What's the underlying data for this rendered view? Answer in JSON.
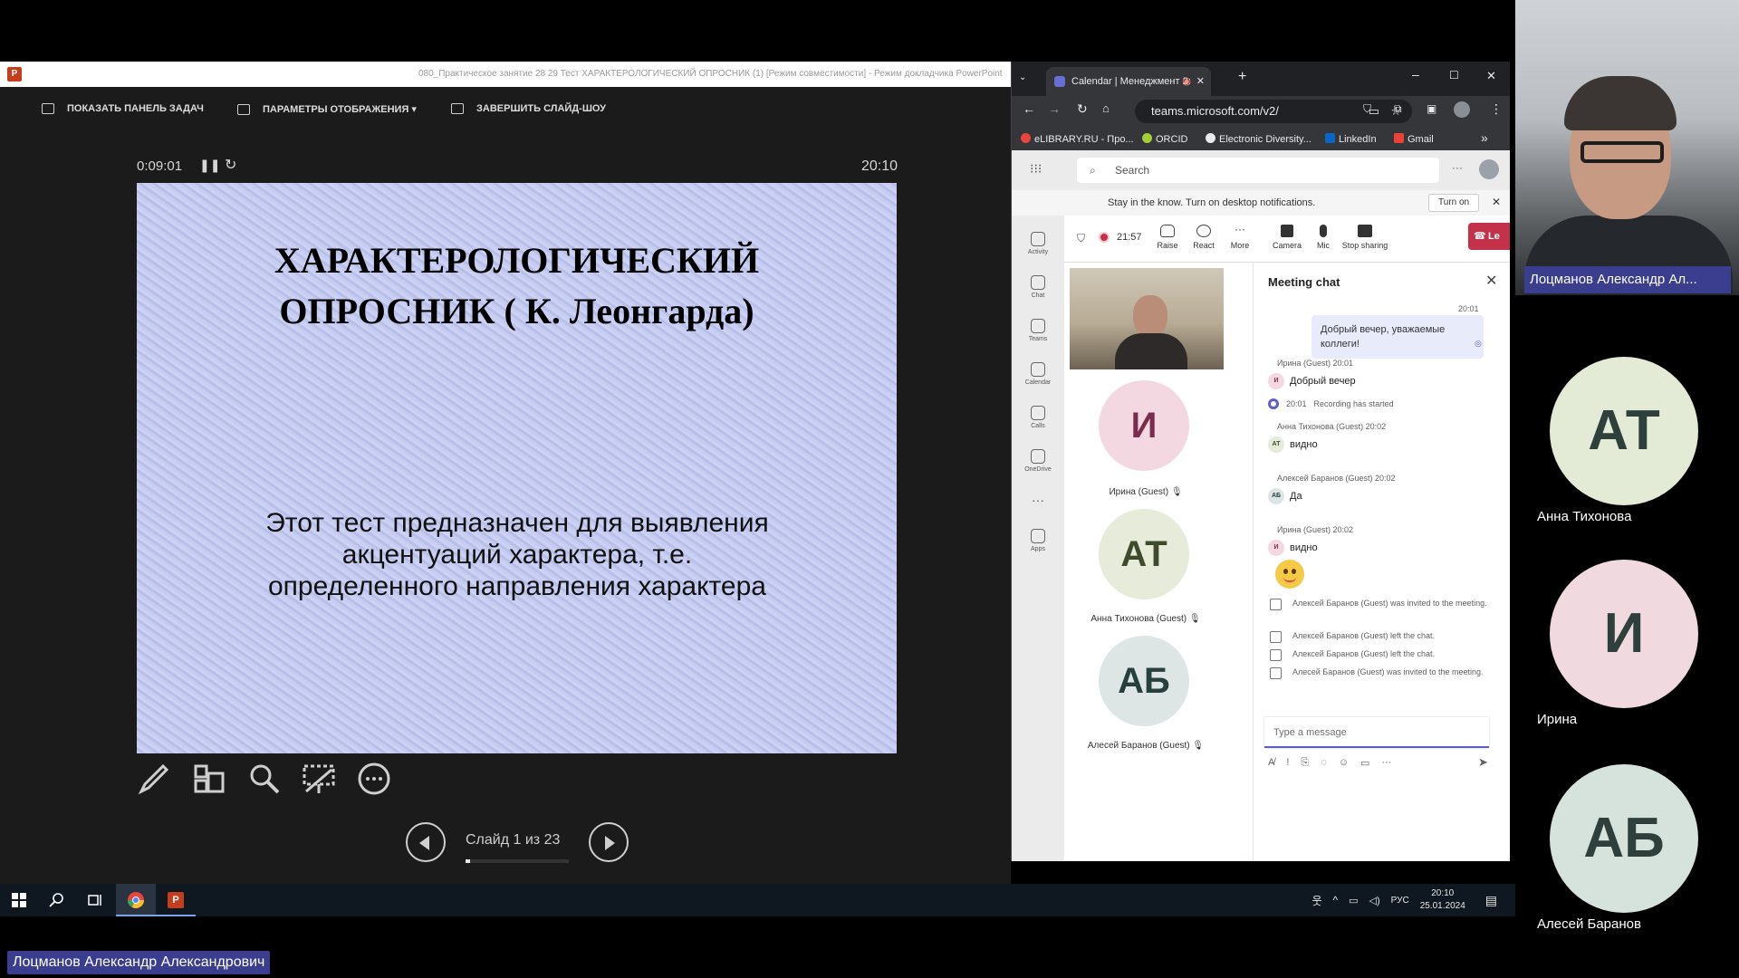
{
  "powerpoint": {
    "window_title": "080_Практическое занятие 28 29 Тест ХАРАКТЕРОЛОГИЧЕСКИЙ ОПРОСНИК (1) [Режим совместимости] - Режим докладчика PowerPoint",
    "toolbar": {
      "show_taskbar": "ПОКАЗАТЬ ПАНЕЛЬ ЗАДАЧ",
      "display_settings": "ПАРАМЕТРЫ ОТОБРАЖЕНИЯ ▾",
      "end_show": "ЗАВЕРШИТЬ СЛАЙД-ШОУ"
    },
    "timer": "0:09:01",
    "clock": "20:10",
    "slide": {
      "title_line1": "ХАРАКТЕРОЛОГИЧЕСКИЙ",
      "title_line2": "ОПРОСНИК ( К. Леонгарда)",
      "body": "Этот тест предназначен для выявления акцентуаций характера, т.е. определенного направления характера"
    },
    "slide_counter": "Слайд 1 из 23",
    "slide_progress": 0.0435
  },
  "taskbar": {
    "lang": "РУС",
    "time": "20:10",
    "date": "25.01.2024"
  },
  "browser": {
    "tab_title": "Calendar | Менеджмент 2:",
    "url": "teams.microsoft.com/v2/",
    "bookmarks": [
      "eLIBRARY.RU - Про...",
      "ORCID",
      "Electronic Diversity...",
      "LinkedIn",
      "Gmail"
    ],
    "bookmark_overflow": "»"
  },
  "teams": {
    "search_placeholder": "Search",
    "notification": "Stay in the know. Turn on desktop notifications.",
    "turn_on": "Turn on",
    "rail": [
      "Activity",
      "Chat",
      "Teams",
      "Calendar",
      "Calls",
      "OneDrive",
      "Apps"
    ],
    "meeting_time": "21:57",
    "controls": [
      "Raise",
      "React",
      "More",
      "Camera",
      "Mic",
      "Stop sharing"
    ],
    "leave": "Le",
    "participants": [
      {
        "initials": "И",
        "name": "Ирина (Guest)",
        "bg": "#f3d8e1",
        "fg": "#7a2c4e"
      },
      {
        "initials": "АТ",
        "name": "Анна Тихонова (Guest)",
        "bg": "#e6ecd9",
        "fg": "#3e4a2b"
      },
      {
        "initials": "АБ",
        "name": "Алесей Баранов (Guest)",
        "bg": "#dde6e5",
        "fg": "#27403d"
      }
    ],
    "chat": {
      "title": "Meeting chat",
      "own_time": "20:01",
      "own_message": "Добрый вечер, уважаемые коллеги!",
      "messages": [
        {
          "meta": "Ирина (Guest)  20:01",
          "initials": "И",
          "text": "Добрый вечер"
        },
        {
          "meta": "Анна Тихонова (Guest)  20:02",
          "initials": "АТ",
          "text": "видно"
        },
        {
          "meta": "Алексей Баранов (Guest)  20:02",
          "initials": "АБ",
          "text": "Да"
        },
        {
          "meta": "Ирина (Guest)  20:02",
          "initials": "И",
          "text": "видно"
        }
      ],
      "recording_time": "20:01",
      "recording_text": "Recording has started",
      "system": [
        "Алексей Баранов (Guest) was invited to the meeting.",
        "Алексей Баранов (Guest) left the chat.",
        "Алексей Баранов (Guest) left the chat.",
        "Алесей Баранов (Guest) was invited to the meeting."
      ],
      "compose_placeholder": "Type a message"
    }
  },
  "gallery": {
    "self_name": "Лоцманов Александр Ал...",
    "tiles": [
      {
        "initials": "АТ",
        "name": "Анна Тихонова",
        "bg": "#e3ead5"
      },
      {
        "initials": "И",
        "name": "Ирина",
        "bg": "#f1d9e0"
      },
      {
        "initials": "АБ",
        "name": "Алесей Баранов",
        "bg": "#d6e2dc"
      }
    ]
  },
  "presenter_tag": "Лоцманов Александр Александрович"
}
